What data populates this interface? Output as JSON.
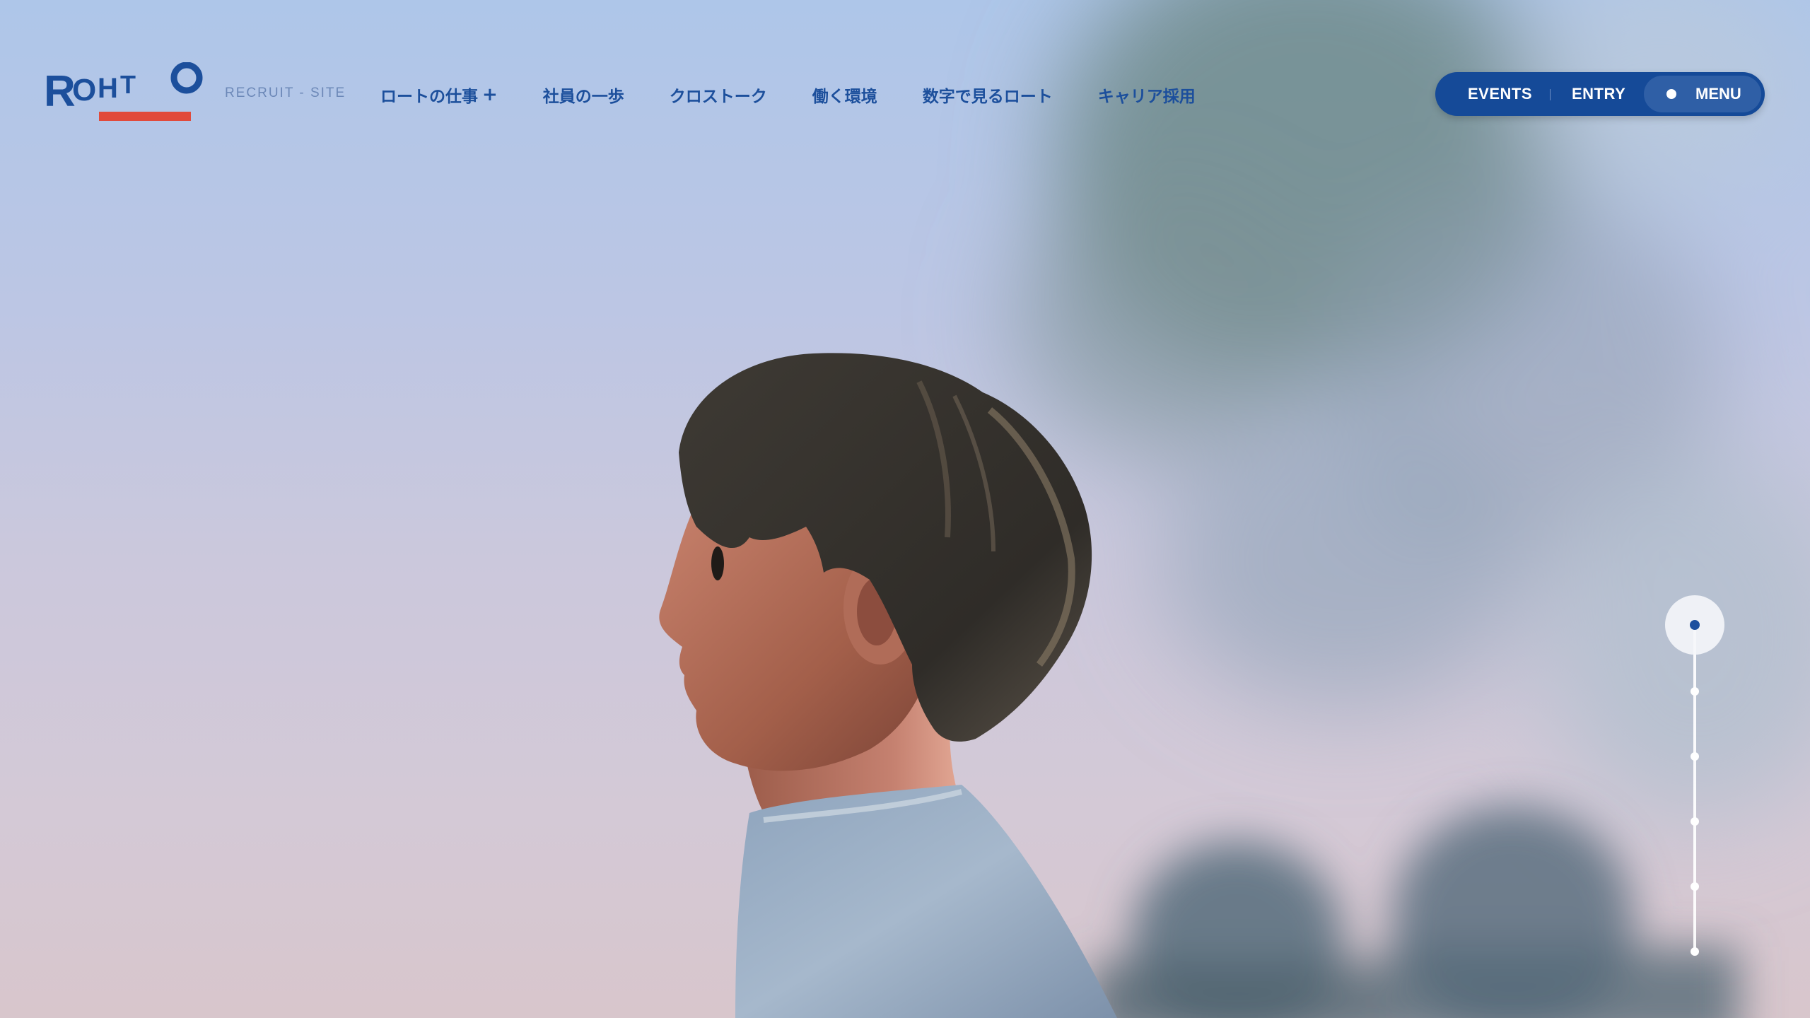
{
  "brand": {
    "logo_text": "ROHTO",
    "subtitle": "RECRUIT - SITE"
  },
  "nav": {
    "items": [
      {
        "label": "ロートの仕事",
        "has_plus": true
      },
      {
        "label": "社員の一歩"
      },
      {
        "label": "クロストーク"
      },
      {
        "label": "働く環境"
      },
      {
        "label": "数字で見るロート"
      },
      {
        "label": "キャリア採用"
      }
    ],
    "plus_symbol": "+"
  },
  "actions": {
    "events_label": "EVENTS",
    "entry_label": "ENTRY",
    "menu_label": "MENU"
  },
  "slider": {
    "total_slides": 6,
    "active_index": 0
  },
  "colors": {
    "brand_blue": "#154a98",
    "nav_text": "#1c4f9c",
    "logo_red": "#e14a3b",
    "subtitle": "#6c88b8"
  },
  "icons": {
    "menu": "dot-icon",
    "nav_expand": "plus-icon"
  }
}
